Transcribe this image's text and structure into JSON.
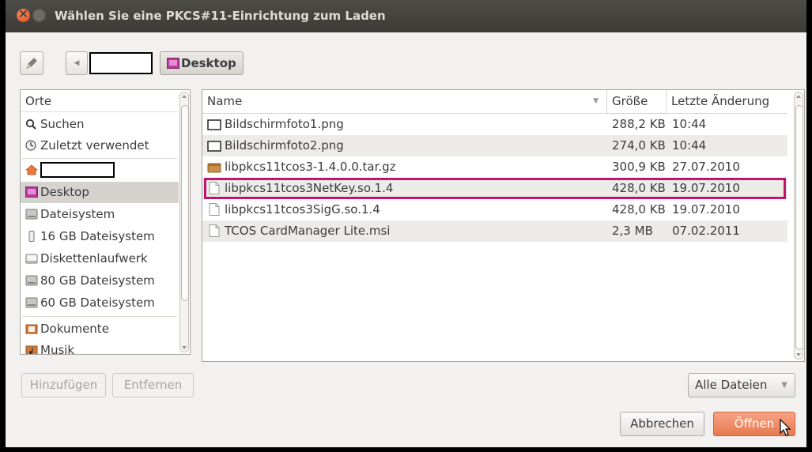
{
  "window": {
    "title": "Wählen Sie eine PKCS#11-Einrichtung zum Laden"
  },
  "pathbar": {
    "current": "Desktop"
  },
  "places": {
    "header": "Orte",
    "items": [
      {
        "label": "Suchen",
        "icon": "search-icon"
      },
      {
        "label": "Zuletzt verwendet",
        "icon": "clock-icon"
      },
      {
        "label": "",
        "icon": "home-folder-icon"
      },
      {
        "label": "Desktop",
        "icon": "desktop-icon",
        "selected": true
      },
      {
        "label": "Dateisystem",
        "icon": "harddisk-icon"
      },
      {
        "label": "16 GB Dateisystem",
        "icon": "usb-drive-icon"
      },
      {
        "label": "Diskettenlaufwerk",
        "icon": "floppy-icon"
      },
      {
        "label": "80 GB Dateisystem",
        "icon": "harddisk-icon"
      },
      {
        "label": "60 GB Dateisystem",
        "icon": "harddisk-icon"
      },
      {
        "label": "Dokumente",
        "icon": "documents-folder-icon"
      },
      {
        "label": "Musik",
        "icon": "music-folder-icon"
      }
    ]
  },
  "files": {
    "columns": {
      "name": "Name",
      "size": "Größe",
      "modified": "Letzte Änderung"
    },
    "rows": [
      {
        "name": "Bildschirmfoto1.png",
        "size": "288,2 KB",
        "modified": "10:44",
        "icon": "image-file-icon"
      },
      {
        "name": "Bildschirmfoto2.png",
        "size": "274,0 KB",
        "modified": "10:44",
        "icon": "image-file-icon"
      },
      {
        "name": "libpkcs11tcos3-1.4.0.0.tar.gz",
        "size": "300,9 KB",
        "modified": "27.07.2010",
        "icon": "archive-file-icon"
      },
      {
        "name": "libpkcs11tcos3NetKey.so.1.4",
        "size": "428,0 KB",
        "modified": "19.07.2010",
        "icon": "file-icon",
        "highlighted": true
      },
      {
        "name": "libpkcs11tcos3SigG.so.1.4",
        "size": "428,0 KB",
        "modified": "19.07.2010",
        "icon": "file-icon"
      },
      {
        "name": "TCOS CardManager Lite.msi",
        "size": "2,3 MB",
        "modified": "07.02.2011",
        "icon": "file-icon"
      }
    ]
  },
  "buttons": {
    "add": "Hinzufügen",
    "remove": "Entfernen",
    "filter": "Alle Dateien",
    "cancel": "Abbrechen",
    "open": "Öffnen"
  },
  "colors": {
    "accent": "#e8794f",
    "highlight_box": "#c0146e",
    "titlebar": "#3c3b37"
  }
}
